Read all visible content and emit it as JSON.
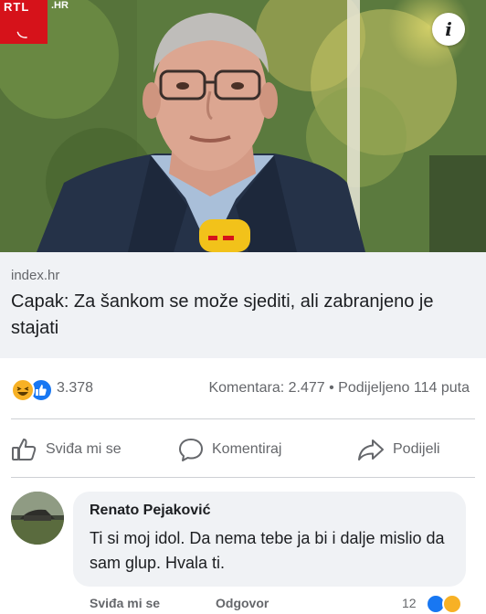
{
  "photo": {
    "logo_text": "RTL",
    "logo_suffix": ".HR",
    "info_glyph": "i",
    "microphone_label": "RTL"
  },
  "link_preview": {
    "domain": "index.hr",
    "title": "Capak: Za šankom se može sjediti, ali zabranjeno je stajati"
  },
  "stats": {
    "reactions": [
      "haha",
      "like"
    ],
    "reaction_count": "3.378",
    "comments_label": "Komentara: 2.477",
    "separator": "•",
    "shares_label": "Podijeljeno 114 puta"
  },
  "actions": {
    "like": "Sviđa mi se",
    "comment": "Komentiraj",
    "share": "Podijeli"
  },
  "comment": {
    "author": "Renato Pejaković",
    "text": "Ti si moj idol. Da nema tebe ja bi i dalje mislio da sam glup. Hvala ti.",
    "like_action": "Sviđa mi se",
    "reply_action": "Odgovor",
    "reaction_count": "12"
  },
  "colors": {
    "facebook_blue": "#1877f2",
    "haha_yellow": "#f7b125",
    "rtl_red": "#d6121a",
    "muted_text": "#65676b"
  }
}
